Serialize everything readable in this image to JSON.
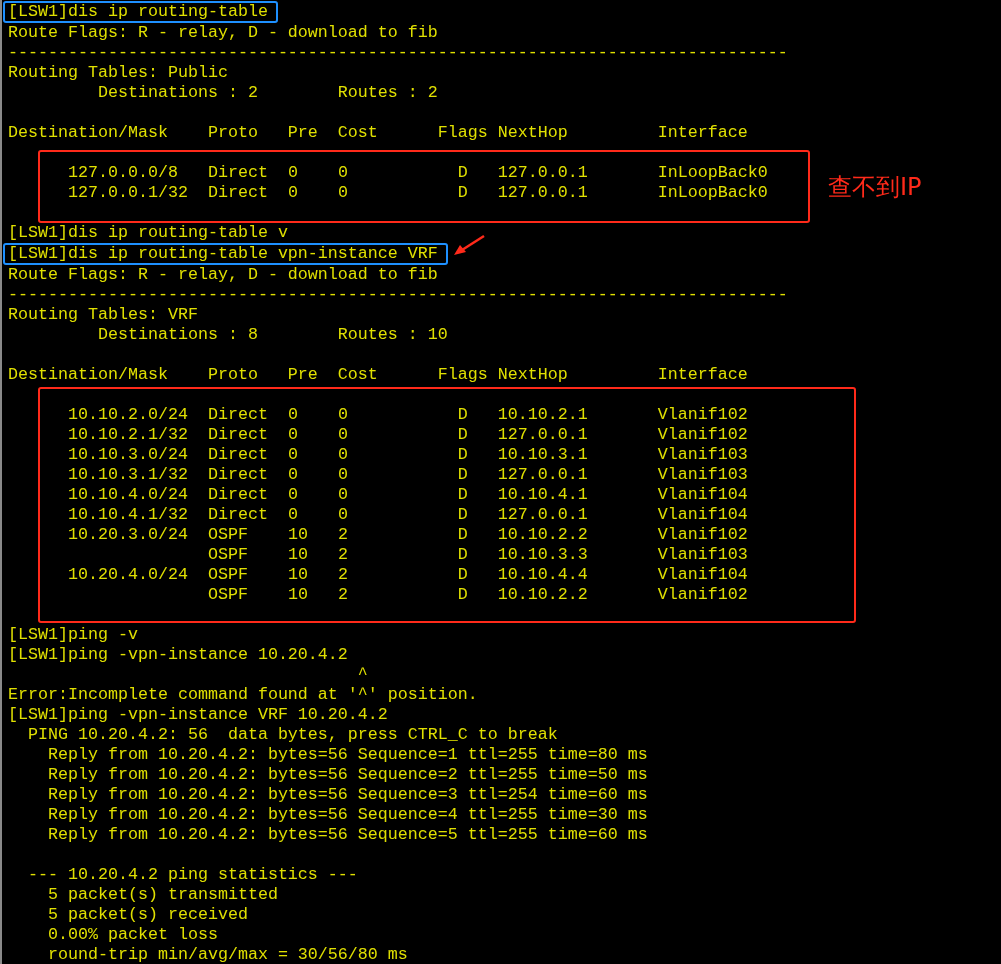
{
  "terminal": {
    "blocks": [
      {
        "kind": "command-highlight",
        "lines": [
          "[LSW1]dis ip routing-table"
        ]
      },
      {
        "kind": "plain",
        "lines": [
          "Route Flags: R - relay, D - download to fib",
          "------------------------------------------------------------------------------",
          "Routing Tables: Public",
          "         Destinations : 2        Routes : 2"
        ]
      },
      {
        "kind": "blank"
      },
      {
        "kind": "plain",
        "lines": [
          "Destination/Mask    Proto   Pre  Cost      Flags NextHop         Interface"
        ]
      },
      {
        "kind": "result-highlight",
        "note": "查不到IP",
        "lines": [
          "127.0.0.0/8   Direct  0    0           D   127.0.0.1       InLoopBack0",
          "127.0.0.1/32  Direct  0    0           D   127.0.0.1       InLoopBack0"
        ]
      },
      {
        "kind": "plain",
        "lines": [
          "[LSW1]dis ip routing-table v"
        ]
      },
      {
        "kind": "command-highlight-arrow",
        "lines": [
          "[LSW1]dis ip routing-table vpn-instance VRF"
        ]
      },
      {
        "kind": "plain",
        "lines": [
          "Route Flags: R - relay, D - download to fib",
          "------------------------------------------------------------------------------",
          "Routing Tables: VRF",
          "         Destinations : 8        Routes : 10"
        ]
      },
      {
        "kind": "blank"
      },
      {
        "kind": "plain",
        "lines": [
          "Destination/Mask    Proto   Pre  Cost      Flags NextHop         Interface"
        ]
      },
      {
        "kind": "result-highlight",
        "lines": [
          "10.10.2.0/24  Direct  0    0           D   10.10.2.1       Vlanif102",
          "10.10.2.1/32  Direct  0    0           D   127.0.0.1       Vlanif102",
          "10.10.3.0/24  Direct  0    0           D   10.10.3.1       Vlanif103",
          "10.10.3.1/32  Direct  0    0           D   127.0.0.1       Vlanif103",
          "10.10.4.0/24  Direct  0    0           D   10.10.4.1       Vlanif104",
          "10.10.4.1/32  Direct  0    0           D   127.0.0.1       Vlanif104",
          "10.20.3.0/24  OSPF    10   2           D   10.10.2.2       Vlanif102",
          "              OSPF    10   2           D   10.10.3.3       Vlanif103",
          "10.20.4.0/24  OSPF    10   2           D   10.10.4.4       Vlanif104",
          "              OSPF    10   2           D   10.10.2.2       Vlanif102"
        ]
      },
      {
        "kind": "plain",
        "lines": [
          "[LSW1]ping -v",
          "[LSW1]ping -vpn-instance 10.20.4.2",
          "                                   ^",
          "Error:Incomplete command found at '^' position.",
          "[LSW1]ping -vpn-instance VRF 10.20.4.2",
          "  PING 10.20.4.2: 56  data bytes, press CTRL_C to break",
          "    Reply from 10.20.4.2: bytes=56 Sequence=1 ttl=255 time=80 ms",
          "    Reply from 10.20.4.2: bytes=56 Sequence=2 ttl=255 time=50 ms",
          "    Reply from 10.20.4.2: bytes=56 Sequence=3 ttl=254 time=60 ms",
          "    Reply from 10.20.4.2: bytes=56 Sequence=4 ttl=255 time=30 ms",
          "    Reply from 10.20.4.2: bytes=56 Sequence=5 ttl=255 time=60 ms"
        ]
      },
      {
        "kind": "blank"
      },
      {
        "kind": "plain",
        "lines": [
          "  --- 10.20.4.2 ping statistics ---",
          "    5 packet(s) transmitted",
          "    5 packet(s) received",
          "    0.00% packet loss",
          "    round-trip min/avg/max = 30/56/80 ms"
        ]
      }
    ]
  }
}
